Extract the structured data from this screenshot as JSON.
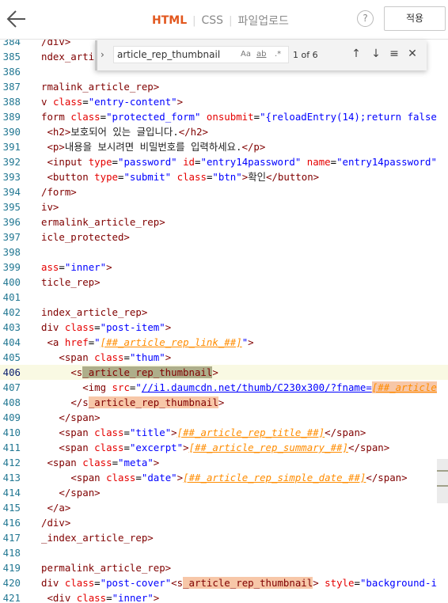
{
  "toolbar": {
    "tabs": [
      {
        "label": "HTML",
        "active": true
      },
      {
        "label": "CSS",
        "active": false
      },
      {
        "label": "파일업로드",
        "active": false
      }
    ],
    "help_label": "?",
    "apply_label": "적용"
  },
  "find": {
    "query": "article_rep_thumbnail",
    "match_case": "Aa",
    "whole_word": "ab",
    "regex": ".*",
    "count": "1 of 6"
  },
  "colors": {
    "accent": "#e2571e",
    "match": "#f7c7a8",
    "current_match": "#aeae8a",
    "line_number": "#237893"
  },
  "lines": [
    {
      "n": "384",
      "html": "<span class=\"t\">/div&gt;</span>"
    },
    {
      "n": "385",
      "html": "<span class=\"t\">ndex_arti</span>"
    },
    {
      "n": "386",
      "html": ""
    },
    {
      "n": "387",
      "html": "<span class=\"t\">rmalink_article_rep&gt;</span>"
    },
    {
      "n": "388",
      "html": "<span class=\"t\">v</span> <span class=\"a\">class</span><span class=\"b\">=</span><span class=\"s\">\"entry-content\"</span><span class=\"t\">&gt;</span>"
    },
    {
      "n": "389",
      "html": "<span class=\"t\">form</span> <span class=\"a\">class</span><span class=\"b\">=</span><span class=\"s\">\"protected_form\"</span> <span class=\"a\">onsubmit</span><span class=\"b\">=</span><span class=\"s\">\"{reloadEntry(14);return false</span>"
    },
    {
      "n": "390",
      "html": " <span class=\"t\">&lt;h2&gt;</span>보호되어 있는 글입니다.<span class=\"t\">&lt;/h2&gt;</span>"
    },
    {
      "n": "391",
      "html": " <span class=\"t\">&lt;p&gt;</span>내용을 보시려면 비밀번호를 입력하세요.<span class=\"t\">&lt;/p&gt;</span>"
    },
    {
      "n": "392",
      "html": " <span class=\"t\">&lt;input</span> <span class=\"a\">type</span><span class=\"b\">=</span><span class=\"s\">\"password\"</span> <span class=\"a\">id</span><span class=\"b\">=</span><span class=\"s\">\"entry14password\"</span> <span class=\"a\">name</span><span class=\"b\">=</span><span class=\"s\">\"entry14password\"</span>"
    },
    {
      "n": "393",
      "html": " <span class=\"t\">&lt;button</span> <span class=\"a\">type</span><span class=\"b\">=</span><span class=\"s\">\"submit\"</span> <span class=\"a\">class</span><span class=\"b\">=</span><span class=\"s\">\"btn\"</span><span class=\"t\">&gt;</span>확인<span class=\"t\">&lt;/button&gt;</span>"
    },
    {
      "n": "394",
      "html": "<span class=\"t\">/form&gt;</span>"
    },
    {
      "n": "395",
      "html": "<span class=\"t\">iv&gt;</span>"
    },
    {
      "n": "396",
      "html": "<span class=\"t\">ermalink_article_rep&gt;</span>"
    },
    {
      "n": "397",
      "html": "<span class=\"t\">icle_protected&gt;</span>"
    },
    {
      "n": "398",
      "html": ""
    },
    {
      "n": "399",
      "html": "<span class=\"a\">ass</span><span class=\"b\">=</span><span class=\"s\">\"inner\"</span><span class=\"t\">&gt;</span>"
    },
    {
      "n": "400",
      "html": "<span class=\"t\">ticle_rep&gt;</span>"
    },
    {
      "n": "401",
      "html": ""
    },
    {
      "n": "402",
      "html": "<span class=\"t\">index_article_rep&gt;</span>"
    },
    {
      "n": "403",
      "html": "<span class=\"t\">div</span> <span class=\"a\">class</span><span class=\"b\">=</span><span class=\"s\">\"post-item\"</span><span class=\"t\">&gt;</span>"
    },
    {
      "n": "404",
      "html": " <span class=\"t\">&lt;a</span> <span class=\"a\">href</span><span class=\"b\">=</span><span class=\"s\">\"</span><span class=\"v\">[##_article_rep_link_##]</span><span class=\"s\">\"</span><span class=\"t\">&gt;</span>"
    },
    {
      "n": "405",
      "html": "   <span class=\"t\">&lt;span</span> <span class=\"a\">class</span><span class=\"b\">=</span><span class=\"s\">\"thum\"</span><span class=\"t\">&gt;</span>"
    },
    {
      "n": "406",
      "cur": true,
      "html": "     <span class=\"t\">&lt;s</span><span class=\"t hlcur\">_article_rep_thumbnail</span><span class=\"t\">&gt;</span>"
    },
    {
      "n": "407",
      "html": "       <span class=\"t\">&lt;img</span> <span class=\"a\">src</span><span class=\"b\">=</span><span class=\"s\">\"</span><span class=\"link\">//i1.daumcdn.net/thumb/C230x300/?fname=</span><span class=\"hl\"><span class=\"v\">[##_article</span></span>"
    },
    {
      "n": "408",
      "html": "     <span class=\"t\">&lt;/s</span><span class=\"t hl\">_article_rep_thumbnail</span><span class=\"t\">&gt;</span>"
    },
    {
      "n": "409",
      "html": "   <span class=\"t\">&lt;/span&gt;</span>"
    },
    {
      "n": "410",
      "html": "   <span class=\"t\">&lt;span</span> <span class=\"a\">class</span><span class=\"b\">=</span><span class=\"s\">\"title\"</span><span class=\"t\">&gt;</span><span class=\"v\">[##_article_rep_title_##]</span><span class=\"t\">&lt;/span&gt;</span>"
    },
    {
      "n": "411",
      "html": "   <span class=\"t\">&lt;span</span> <span class=\"a\">class</span><span class=\"b\">=</span><span class=\"s\">\"excerpt\"</span><span class=\"t\">&gt;</span><span class=\"v\">[##_article_rep_summary_##]</span><span class=\"t\">&lt;/span&gt;</span>"
    },
    {
      "n": "412",
      "html": " <span class=\"t\">&lt;span</span> <span class=\"a\">class</span><span class=\"b\">=</span><span class=\"s\">\"meta\"</span><span class=\"t\">&gt;</span>"
    },
    {
      "n": "413",
      "html": "     <span class=\"t\">&lt;span</span> <span class=\"a\">class</span><span class=\"b\">=</span><span class=\"s\">\"date\"</span><span class=\"t\">&gt;</span><span class=\"v\">[##_article_rep_simple_date_##]</span><span class=\"t\">&lt;/span&gt;</span>"
    },
    {
      "n": "414",
      "html": "   <span class=\"t\">&lt;/span&gt;</span>"
    },
    {
      "n": "415",
      "html": " <span class=\"t\">&lt;/a&gt;</span>"
    },
    {
      "n": "416",
      "html": "<span class=\"t\">/div&gt;</span>"
    },
    {
      "n": "417",
      "html": "<span class=\"t\">_index_article_rep&gt;</span>"
    },
    {
      "n": "418",
      "html": ""
    },
    {
      "n": "419",
      "html": "<span class=\"t\">permalink_article_rep&gt;</span>"
    },
    {
      "n": "420",
      "html": "<span class=\"t\">div</span> <span class=\"a\">class</span><span class=\"b\">=</span><span class=\"s\">\"post-cover\"</span><span class=\"t\">&lt;s</span><span class=\"t hl\">_article_rep_thumbnail</span><span class=\"t\">&gt;</span> <span class=\"a\">style</span><span class=\"b\">=</span><span class=\"s\">\"background-i</span>"
    },
    {
      "n": "421",
      "html": " <span class=\"t\">&lt;div</span> <span class=\"a\">class</span><span class=\"b\">=</span><span class=\"s\">\"inner\"</span><span class=\"t\">&gt;</span>"
    }
  ]
}
